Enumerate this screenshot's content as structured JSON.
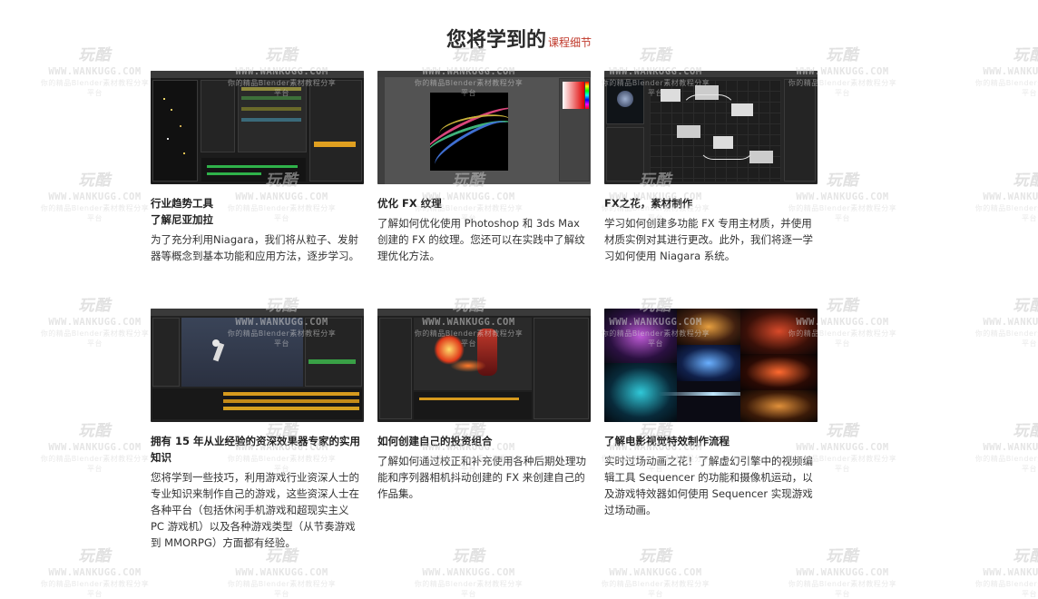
{
  "header": {
    "title": "您将学到的",
    "subtitle": "课程细节"
  },
  "watermark": {
    "logo": "玩酷",
    "url": "WWW.WANKUGG.COM",
    "tagline": "你的精品Blender素材教程分享平台"
  },
  "cards": [
    {
      "image": "niagara-editor-screenshot",
      "title": "行业趋势工具\n了解尼亚加拉",
      "desc": "为了充分利用Niagara，我们将从粒子、发射器等概念到基本功能和应用方法，逐步学习。"
    },
    {
      "image": "photoshop-fx-texture-screenshot",
      "title": "优化 FX 纹理",
      "desc": "了解如何优化使用 Photoshop 和 3ds Max 创建的 FX 的纹理。您还可以在实践中了解纹理优化方法。"
    },
    {
      "image": "material-graph-screenshot",
      "title": "FX之花，素材制作",
      "desc": "学习如何创建多功能 FX 专用主材质，并使用材质实例对其进行更改。此外，我们将逐一学习如何使用 Niagara 系统。"
    },
    {
      "image": "character-fx-editor-screenshot",
      "title": "拥有 15 年从业经验的资深效果器专家的实用知识",
      "desc": "您将学到一些技巧，利用游戏行业资深人士的专业知识来制作自己的游戏，这些资深人士在各种平台（包括休闲手机游戏和超现实主义 PC 游戏机）以及各种游戏类型（从节奏游戏到 MMORPG）方面都有经验。"
    },
    {
      "image": "portfolio-fire-effect-screenshot",
      "title": "如何创建自己的投资组合",
      "desc": "了解如何通过校正和补充使用各种后期处理功能和序列器相机抖动创建的 FX 来创建自己的作品集。"
    },
    {
      "image": "cinematic-vfx-collage",
      "title": "了解电影视觉特效制作流程",
      "desc": "实时过场动画之花！了解虚幻引擎中的视频编辑工具 Sequencer 的功能和摄像机运动，以及游戏特效器如何使用 Sequencer 实现游戏过场动画。"
    }
  ]
}
